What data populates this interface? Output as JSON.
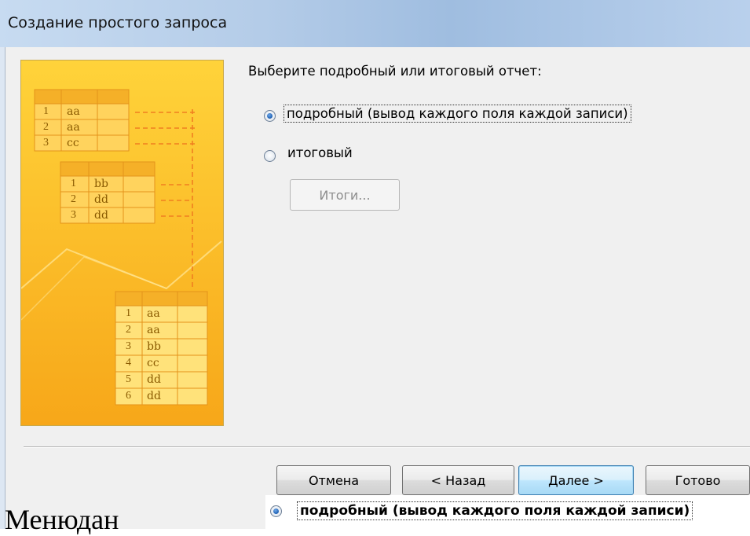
{
  "window": {
    "title": "Создание простого запроса"
  },
  "prompt": "Выберите подробный или итоговый отчет:",
  "options": [
    {
      "label": "подробный (вывод каждого поля каждой записи)",
      "checked": true
    },
    {
      "label": "итоговый",
      "checked": false
    }
  ],
  "totals_button": "Итоги...",
  "buttons": {
    "cancel": "Отмена",
    "back": "< Назад",
    "next": "Далее >",
    "finish": "Готово"
  },
  "illustration": {
    "table1": [
      {
        "n": "1",
        "v": "aa"
      },
      {
        "n": "2",
        "v": "aa"
      },
      {
        "n": "3",
        "v": "cc"
      }
    ],
    "table2": [
      {
        "n": "1",
        "v": "bb"
      },
      {
        "n": "2",
        "v": "dd"
      },
      {
        "n": "3",
        "v": "dd"
      }
    ],
    "table3": [
      {
        "n": "1",
        "v": "aa"
      },
      {
        "n": "2",
        "v": "aa"
      },
      {
        "n": "3",
        "v": "bb"
      },
      {
        "n": "4",
        "v": "cc"
      },
      {
        "n": "5",
        "v": "dd"
      },
      {
        "n": "6",
        "v": "dd"
      }
    ]
  },
  "bottom_strip": {
    "label": "подробный (вывод каждого поля каждой записи)"
  },
  "caption": "Менюдан"
}
